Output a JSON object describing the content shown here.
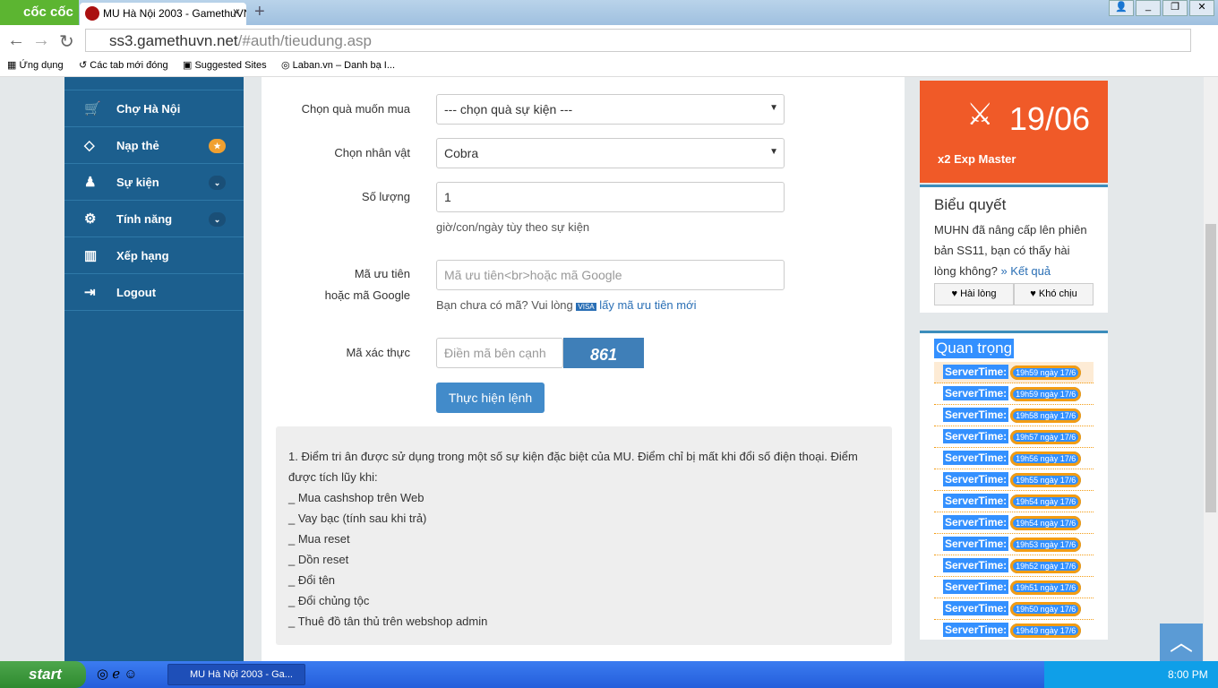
{
  "browser": {
    "brand": "cốc cốc",
    "tab_title": "MU Hà Nội 2003 - GamethuVN",
    "url_host": "ss3.gamethuvn.net",
    "url_path": "/#auth/tieudung.asp",
    "bookmarks": [
      "Ứng dụng",
      "Các tab mới đóng",
      "Suggested Sites",
      "Laban.vn – Danh bạ I..."
    ]
  },
  "sidebar": {
    "items": [
      {
        "label": "Chợ Hà Nội",
        "icon": "cart-icon"
      },
      {
        "label": "Nạp thẻ",
        "icon": "diamond-icon",
        "badge": "★"
      },
      {
        "label": "Sự kiện",
        "icon": "android-icon",
        "badge": "⌄"
      },
      {
        "label": "Tính năng",
        "icon": "gears-icon",
        "badge": "⌄"
      },
      {
        "label": "Xếp hạng",
        "icon": "bar-chart-icon"
      },
      {
        "label": "Logout",
        "icon": "sign-out-icon"
      }
    ]
  },
  "form": {
    "gift_label": "Chọn quà muốn mua",
    "gift_value": "--- chọn quà sự kiện ---",
    "char_label": "Chọn nhân vật",
    "char_value": "Cobra",
    "qty_label": "Số lượng",
    "qty_value": "1",
    "qty_help": "giờ/con/ngày tùy theo sự kiện",
    "code_label1": "Mã ưu tiên",
    "code_label2": "hoặc mã Google",
    "code_placeholder": "Mã ưu tiên<br>hoặc mã Google",
    "code_help": "Bạn chưa có mã? Vui lòng",
    "code_link": "lấy mã ưu tiên mới",
    "captcha_label": "Mã xác thực",
    "captcha_placeholder": "Điền mã bên cạnh",
    "captcha_text": "861",
    "submit": "Thực hiện lệnh"
  },
  "note": [
    "1. Điểm tri ân được sử dụng trong một số sự kiện đặc biệt của MU. Điểm chỉ bị mất khi đổi số điện thoại. Điểm được tích lũy khi:",
    "_ Mua cashshop trên Web",
    "_ Vay bạc (tính sau khi trả)",
    "_ Mua reset",
    "_ Dồn reset",
    "_ Đổi tên",
    "_ Đổi chủng tộc",
    "_ Thuê đồ tân thủ trên webshop admin"
  ],
  "event": {
    "date": "19/06",
    "title": "x2 Exp Master",
    "color": "#f05a28"
  },
  "poll": {
    "title": "Biểu quyết",
    "text": "MUHN đã nâng cấp lên phiên bản SS11, bạn có thấy hài lòng không?",
    "result_link": "» Kết quả",
    "yes": "♥ Hài lòng",
    "no": "♥ Khó chịu"
  },
  "important": {
    "title": "Quan trọng",
    "key": "ServerTime:",
    "times": [
      "19h59 ngày 17/6",
      "19h59 ngày 17/6",
      "19h58 ngày 17/6",
      "19h57 ngày 17/6",
      "19h56 ngày 17/6",
      "19h55 ngày 17/6",
      "19h54 ngày 17/6",
      "19h54 ngày 17/6",
      "19h53 ngày 17/6",
      "19h52 ngày 17/6",
      "19h51 ngày 17/6",
      "19h50 ngày 17/6",
      "19h49 ngày 17/6"
    ]
  },
  "taskbar": {
    "start": "start",
    "window": "MU Hà Nội 2003 - Ga...",
    "clock": "8:00 PM"
  }
}
